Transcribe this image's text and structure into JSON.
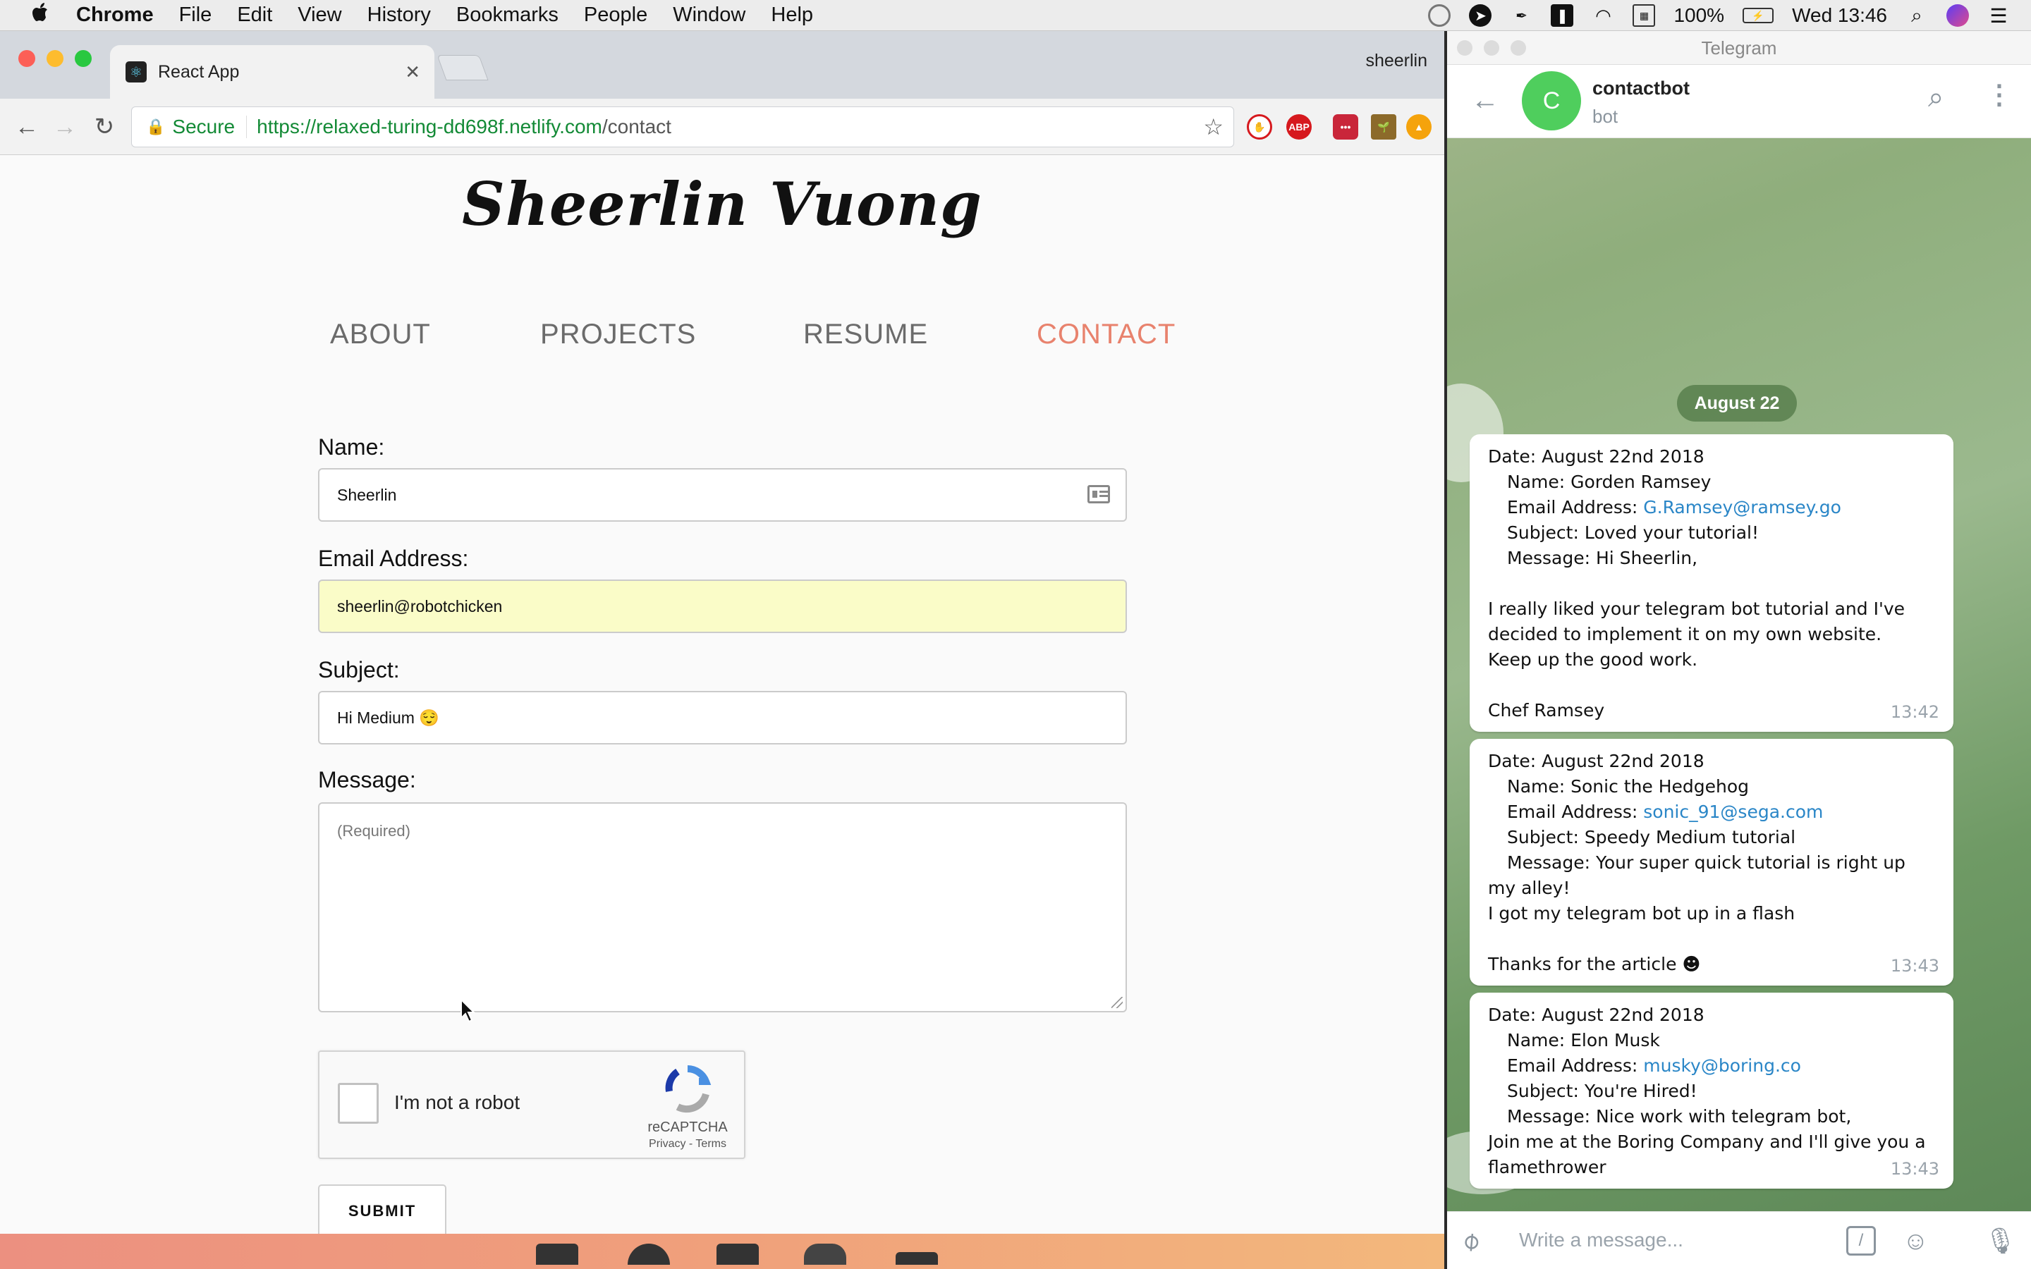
{
  "menubar": {
    "app": "Chrome",
    "items": [
      "File",
      "Edit",
      "View",
      "History",
      "Bookmarks",
      "People",
      "Window",
      "Help"
    ],
    "battery": "100%",
    "clock": "Wed 13:46"
  },
  "browser": {
    "tab_title": "React App",
    "profile": "sheerlin",
    "secure_label": "Secure",
    "url_host": "https://relaxed-turing-dd698f.netlify.com",
    "url_path": "/contact",
    "extensions": [
      "ABP"
    ]
  },
  "site": {
    "title": "Sheerlin Vuong",
    "nav": [
      "ABOUT",
      "PROJECTS",
      "RESUME",
      "CONTACT"
    ],
    "active_nav": "CONTACT",
    "accent": "#e8826d",
    "form": {
      "name_label": "Name:",
      "name_value": "Sheerlin",
      "email_label": "Email Address:",
      "email_value": "sheerlin@robotchicken",
      "subject_label": "Subject:",
      "subject_value": "Hi Medium 😌",
      "message_label": "Message:",
      "message_placeholder": "(Required)",
      "captcha_text": "I'm not a robot",
      "captcha_brand": "reCAPTCHA",
      "captcha_terms": "Privacy - Terms",
      "submit_label": "SUBMIT"
    }
  },
  "telegram": {
    "window_title": "Telegram",
    "chat_name": "contactbot",
    "chat_status": "bot",
    "avatar_letter": "C",
    "date_pill": "August 22",
    "input_placeholder": "Write a message...",
    "messages": [
      {
        "date": "Date: August 22nd 2018",
        "name": "Name:  Gorden Ramsey",
        "email_label": "Email Address: ",
        "email": "G.Ramsey@ramsey.go",
        "subject": "Subject: Loved your tutorial!",
        "message_head": "Message: Hi Sheerlin,",
        "body": [
          "I really liked your telegram bot tutorial and I've decided to implement it on my own website.",
          "Keep up the good work."
        ],
        "sign": "Chef Ramsey",
        "time": "13:42"
      },
      {
        "date": "Date: August 22nd 2018",
        "name": "Name: Sonic the Hedgehog",
        "email_label": "Email Address: ",
        "email": "sonic_91@sega.com",
        "subject": "Subject: Speedy Medium tutorial",
        "message_head": "Message: Your super quick tutorial is right up my alley!",
        "body": [
          "I got my telegram bot up in a flash"
        ],
        "sign": "Thanks for the article ☻",
        "time": "13:43"
      },
      {
        "date": "Date: August 22nd 2018",
        "name": "Name: Elon Musk",
        "email_label": "Email Address: ",
        "email": "musky@boring.co",
        "subject": "Subject: You're Hired!",
        "message_head": "Message:  Nice work with telegram bot,",
        "body": [
          "Join me at the Boring Company and I'll give you a flamethrower"
        ],
        "time": "13:43"
      }
    ]
  }
}
